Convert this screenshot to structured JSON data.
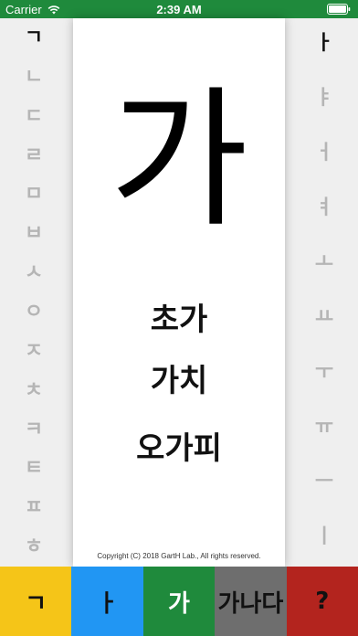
{
  "status_bar": {
    "carrier": "Carrier",
    "time": "2:39 AM",
    "wifi_icon": "wifi-icon",
    "battery_icon": "battery-icon"
  },
  "consonants": [
    "ㄱ",
    "ㄴ",
    "ㄷ",
    "ㄹ",
    "ㅁ",
    "ㅂ",
    "ㅅ",
    "ㅇ",
    "ㅈ",
    "ㅊ",
    "ㅋ",
    "ㅌ",
    "ㅍ",
    "ㅎ"
  ],
  "selected_consonant": "ㄱ",
  "vowels": [
    "ㅏ",
    "ㅑ",
    "ㅓ",
    "ㅕ",
    "ㅗ",
    "ㅛ",
    "ㅜ",
    "ㅠ",
    "ㅡ",
    "ㅣ"
  ],
  "selected_vowel": "ㅏ",
  "card": {
    "syllable": "가",
    "examples": [
      "초가",
      "가치",
      "오가피"
    ],
    "copyright": "Copyright (C) 2018 GartH Lab., All rights reserved."
  },
  "tabs": [
    {
      "label": "ㄱ",
      "bg": "#f5c518",
      "color": "#111111"
    },
    {
      "label": "ㅏ",
      "bg": "#2196f3",
      "color": "#111111"
    },
    {
      "label": "가",
      "bg": "#1f8a3c",
      "color": "#ffffff"
    },
    {
      "label": "가나다",
      "bg": "#6e6e6e",
      "color": "#111111"
    },
    {
      "label": "?",
      "bg": "#b3241e",
      "color": "#111111"
    }
  ],
  "colors": {
    "status_bar": "#1f8a3c",
    "side_inactive": "#b5b5b5",
    "side_active": "#111111"
  }
}
